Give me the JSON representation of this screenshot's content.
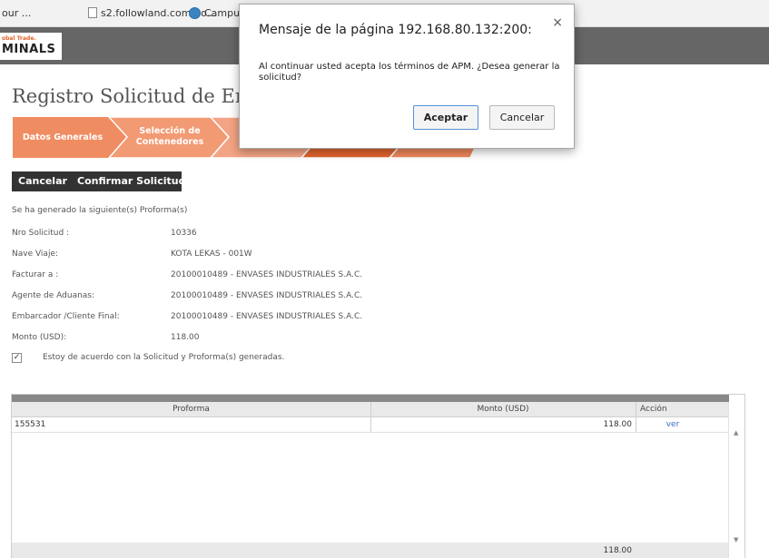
{
  "bookmarks": [
    "our ...",
    "s2.followland.com/no...",
    "Campus"
  ],
  "header": {
    "logo_small": "obal Trade.",
    "logo_big": "MINALS"
  },
  "page_title": "Registro Solicitud de Embarq",
  "steps": [
    {
      "label_line1": "Datos Generales",
      "label_line2": ""
    },
    {
      "label_line1": "Selección de",
      "label_line2": "Contenedores"
    }
  ],
  "actions": {
    "cancel": "Cancelar",
    "confirm": "Confirmar Solicitud"
  },
  "message": "Se ha generado la siguiente(s) Proforma(s)",
  "details": [
    {
      "label": "Nro Solicitud :",
      "value": "10336"
    },
    {
      "label": "Nave Viaje:",
      "value": "KOTA LEKAS - 001W"
    },
    {
      "label": "Facturar a :",
      "value": "20100010489 - ENVASES INDUSTRIALES S.A.C."
    },
    {
      "label": "Agente de Aduanas:",
      "value": "20100010489 - ENVASES INDUSTRIALES S.A.C."
    },
    {
      "label": "Embarcador /Cliente Final:",
      "value": "20100010489 - ENVASES INDUSTRIALES S.A.C."
    },
    {
      "label": "Monto (USD):",
      "value": "118.00"
    }
  ],
  "agreement": {
    "checked": true,
    "mark": "✓",
    "label": "Estoy de acuerdo con la Solicitud y Proforma(s) generadas."
  },
  "grid": {
    "columns": [
      "Proforma",
      "Monto (USD)",
      "Acción"
    ],
    "rows": [
      {
        "proforma": "155531",
        "monto": "118.00",
        "accion": "ver"
      }
    ],
    "footer_total": "118.00"
  },
  "dialog": {
    "title": "Mensaje de la página 192.168.80.132:200:",
    "message": "Al continuar usted acepta los términos de APM. ¿Desea generar la solicitud?",
    "ok": "Aceptar",
    "cancel": "Cancelar",
    "close": "×"
  },
  "colors": {
    "step_active": "#f08c62",
    "step_dark": "#e0632d",
    "header": "#666666",
    "link": "#3a6fc4"
  }
}
